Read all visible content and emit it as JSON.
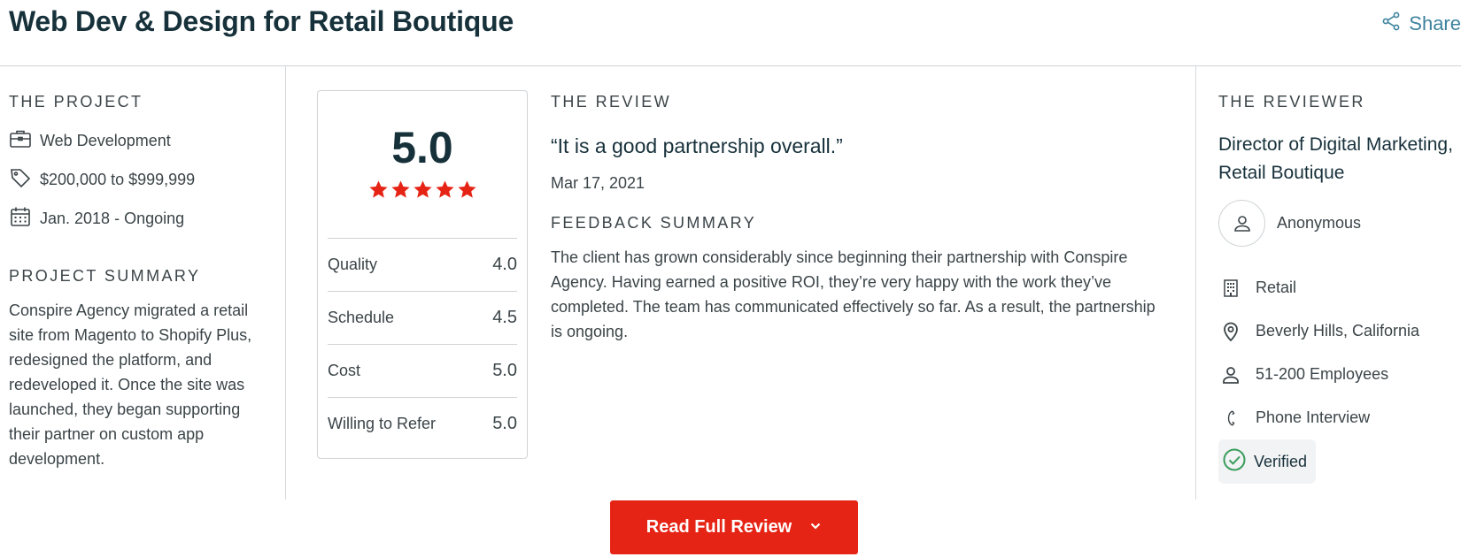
{
  "header": {
    "title": "Web Dev & Design for Retail Boutique",
    "share_label": "Share"
  },
  "project": {
    "section_label": "THE PROJECT",
    "items": [
      {
        "icon": "briefcase-icon",
        "text": "Web Development"
      },
      {
        "icon": "price-tag-icon",
        "text": "$200,000 to $999,999"
      },
      {
        "icon": "calendar-icon",
        "text": "Jan. 2018 - Ongoing"
      }
    ],
    "summary_label": "PROJECT SUMMARY",
    "summary_text": "Conspire Agency migrated a retail site from Magento to Shopify Plus, redesigned the platform, and redeveloped it. Once the site was launched, they began supporting their partner on custom app development."
  },
  "rating": {
    "overall": "5.0",
    "stars": 5,
    "star_color": "#e62415",
    "rows": [
      {
        "label": "Quality",
        "value": "4.0"
      },
      {
        "label": "Schedule",
        "value": "4.5"
      },
      {
        "label": "Cost",
        "value": "5.0"
      },
      {
        "label": "Willing to Refer",
        "value": "5.0"
      }
    ]
  },
  "review": {
    "section_label": "THE REVIEW",
    "quote": "“It is a good partnership overall.”",
    "date": "Mar 17, 2021",
    "feedback_label": "FEEDBACK SUMMARY",
    "feedback_text": "The client has grown considerably since beginning their partnership with Conspire Agency. Having earned a positive ROI, they’re very happy with the work they’ve completed. The team has communicated effectively so far. As a result, the partnership is ongoing."
  },
  "reviewer": {
    "section_label": "THE REVIEWER",
    "title_line1": "Director of Digital Marketing,",
    "title_line2": "Retail Boutique",
    "name": "Anonymous",
    "items": [
      {
        "icon": "building-icon",
        "text": "Retail"
      },
      {
        "icon": "location-pin-icon",
        "text": "Beverly Hills, California"
      },
      {
        "icon": "person-icon",
        "text": "51-200 Employees"
      },
      {
        "icon": "phone-icon",
        "text": "Phone Interview"
      }
    ],
    "verified_label": "Verified",
    "verified_color": "#3a9d5d"
  },
  "actions": {
    "read_full_review_label": "Read Full Review",
    "button_color": "#e62415"
  },
  "colors": {
    "heading": "#17313b",
    "text": "#3b4448",
    "link": "#3e839e",
    "divider": "#cfd3d6"
  }
}
